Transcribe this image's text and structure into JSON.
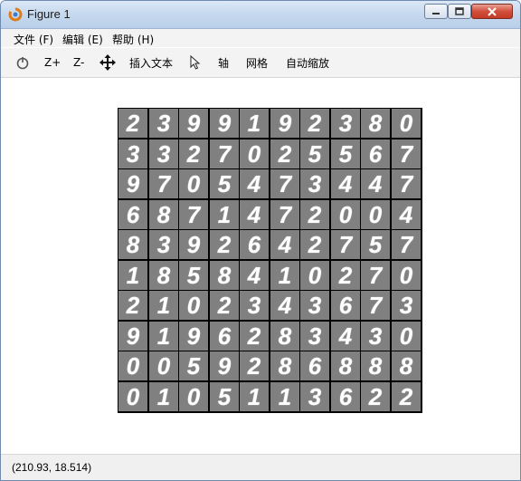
{
  "window": {
    "title": "Figure 1"
  },
  "menu": {
    "items": [
      "文件 (F)",
      "编辑 (E)",
      "帮助 (H)"
    ]
  },
  "toolbar": {
    "zoom_in_label": "Z+",
    "zoom_out_label": "Z-",
    "insert_text_label": "插入文本",
    "axis_label": "轴",
    "grid_label": "网格",
    "auto_zoom_label": "自动缩放"
  },
  "digits": [
    [
      "2",
      "3",
      "9",
      "9",
      "1",
      "9",
      "2",
      "3",
      "8",
      "0"
    ],
    [
      "3",
      "3",
      "2",
      "7",
      "0",
      "2",
      "5",
      "5",
      "6",
      "7"
    ],
    [
      "9",
      "7",
      "0",
      "5",
      "4",
      "7",
      "3",
      "4",
      "4",
      "7"
    ],
    [
      "6",
      "8",
      "7",
      "1",
      "4",
      "7",
      "2",
      "0",
      "0",
      "4"
    ],
    [
      "8",
      "3",
      "9",
      "2",
      "6",
      "4",
      "2",
      "7",
      "5",
      "7"
    ],
    [
      "1",
      "8",
      "5",
      "8",
      "4",
      "1",
      "0",
      "2",
      "7",
      "0"
    ],
    [
      "2",
      "1",
      "0",
      "2",
      "3",
      "4",
      "3",
      "6",
      "7",
      "3"
    ],
    [
      "9",
      "1",
      "9",
      "6",
      "2",
      "8",
      "3",
      "4",
      "3",
      "0"
    ],
    [
      "0",
      "0",
      "5",
      "9",
      "2",
      "8",
      "6",
      "8",
      "8",
      "8"
    ],
    [
      "0",
      "1",
      "0",
      "5",
      "1",
      "1",
      "3",
      "6",
      "2",
      "2"
    ]
  ],
  "status": {
    "coords": "(210.93, 18.514)"
  }
}
